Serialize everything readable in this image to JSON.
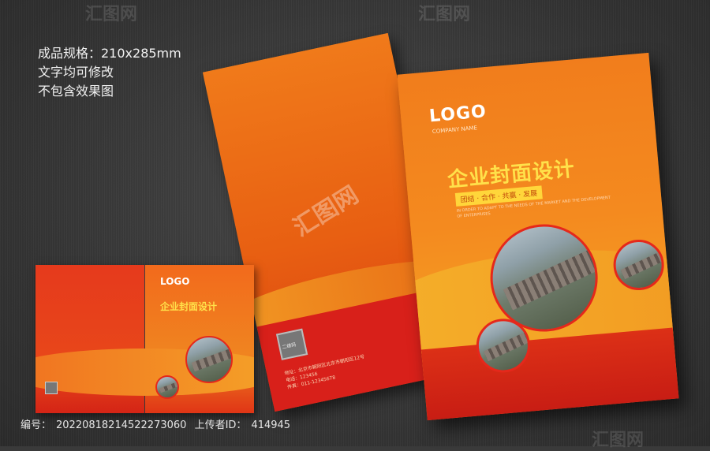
{
  "spec_lines": [
    "成品规格：210x285mm",
    "文字均可修改",
    "不包含效果图"
  ],
  "front_cover": {
    "logo": "LOGO",
    "company": "COMPANY NAME",
    "title": "企业封面设计",
    "tags": "团结 · 合作 · 共赢 · 发展",
    "body_text": "IN ORDER TO ADAPT TO THE NEEDS OF THE MARKET AND THE DEVELOPMENT OF ENTERPRISES"
  },
  "back_cover": {
    "qr_label": "二维码",
    "address_lines": [
      "地址：北京市朝阳区北京市朝阳区12号",
      "电话：123456",
      "传真：011-12345678"
    ]
  },
  "spread": {
    "logo": "LOGO",
    "title": "企业封面设计"
  },
  "footer": {
    "id_label": "编号：",
    "id_value": "20220818214522273060",
    "uploader_label": "上传者ID：",
    "uploader_value": "414945"
  },
  "watermark": "汇图网"
}
